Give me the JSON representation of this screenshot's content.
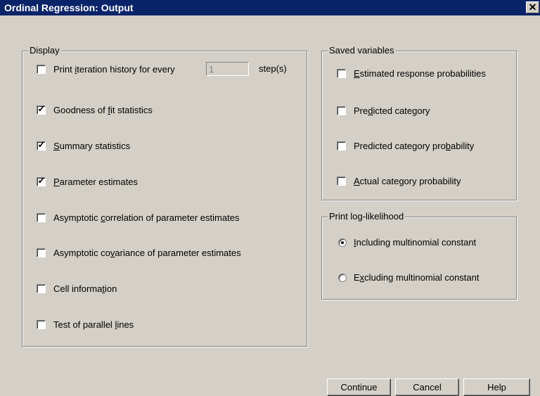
{
  "window": {
    "title": "Ordinal Regression: Output",
    "close_glyph": "✕"
  },
  "display": {
    "legend": "Display",
    "iteration": {
      "before": "Print ",
      "key": "i",
      "after": "teration history for every",
      "value": "1",
      "steps": "step(s)",
      "checked": false
    },
    "items": [
      {
        "before": "Goodness of ",
        "key": "f",
        "after": "it statistics",
        "checked": true
      },
      {
        "before": "",
        "key": "S",
        "after": "ummary statistics",
        "checked": true
      },
      {
        "before": "",
        "key": "P",
        "after": "arameter estimates",
        "checked": true
      },
      {
        "before": "Asymptotic ",
        "key": "c",
        "after": "orrelation of parameter estimates",
        "checked": false
      },
      {
        "before": "Asymptotic co",
        "key": "v",
        "after": "ariance of parameter estimates",
        "checked": false
      },
      {
        "before": "Cell informa",
        "key": "t",
        "after": "ion",
        "checked": false
      },
      {
        "before": "Test of parallel ",
        "key": "l",
        "after": "ines",
        "checked": false
      }
    ]
  },
  "saved": {
    "legend": "Saved variables",
    "items": [
      {
        "before": "",
        "key": "E",
        "after": "stimated response probabilities",
        "checked": false
      },
      {
        "before": "Pre",
        "key": "d",
        "after": "icted category",
        "checked": false
      },
      {
        "before": "Predicted category pro",
        "key": "b",
        "after": "ability",
        "checked": false
      },
      {
        "before": "",
        "key": "A",
        "after": "ctual category probability",
        "checked": false
      }
    ]
  },
  "loglik": {
    "legend": "Print log-likelihood",
    "options": [
      {
        "before": "",
        "key": "I",
        "after": "ncluding multinomial constant",
        "selected": true
      },
      {
        "before": "E",
        "key": "x",
        "after": "cluding multinomial constant",
        "selected": false
      }
    ]
  },
  "buttons": {
    "continue": "Continue",
    "cancel": "Cancel",
    "help": "Help"
  },
  "check_glyph": "✓"
}
